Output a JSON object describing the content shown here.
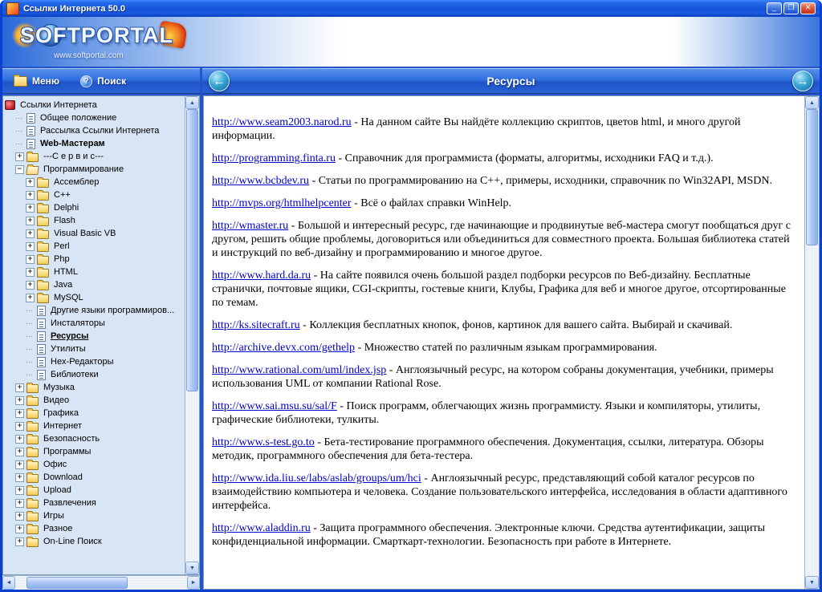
{
  "window": {
    "title": "Ссылки Интернета 50.0"
  },
  "banner": {
    "logo": "SOFTPORTAL",
    "site": "www.softportal.com"
  },
  "toolbar": {
    "menu": "Меню",
    "search": "Поиск"
  },
  "panel": {
    "title": "Ресурсы"
  },
  "icons": {
    "minimize": "_",
    "maximize": "❐",
    "close": "✕",
    "arrow_left": "←",
    "arrow_right": "→",
    "scroll_up": "▲",
    "scroll_down": "▼",
    "scroll_left": "◄",
    "scroll_right": "►",
    "help": "?",
    "plus": "+",
    "minus": "−"
  },
  "colors": {
    "titlebar": "#1a5ae0",
    "link": "#0000cc",
    "tree_bg": "#d8e5f4",
    "winbg": "#2355c8"
  },
  "tree": {
    "items": [
      {
        "label": "Ссылки Интернета",
        "icon": "root",
        "expand": "none",
        "level": 0
      },
      {
        "label": "Общее положение",
        "icon": "doc",
        "expand": "none",
        "level": 1
      },
      {
        "label": "Рассылка Ссылки Интернета",
        "icon": "doc",
        "expand": "none",
        "level": 1
      },
      {
        "label": "Web-Мастерам",
        "icon": "doc",
        "expand": "none",
        "level": 1,
        "bold": true
      },
      {
        "label": "---С е р в и с---",
        "icon": "folder",
        "expand": "plus",
        "level": 1
      },
      {
        "label": "Программирование",
        "icon": "folder-open",
        "expand": "minus",
        "level": 1
      },
      {
        "label": "Ассемблер",
        "icon": "folder",
        "expand": "plus",
        "level": 2
      },
      {
        "label": "C++",
        "icon": "folder",
        "expand": "plus",
        "level": 2
      },
      {
        "label": "Delphi",
        "icon": "folder",
        "expand": "plus",
        "level": 2
      },
      {
        "label": "Flash",
        "icon": "folder",
        "expand": "plus",
        "level": 2
      },
      {
        "label": "Visual Basic VB",
        "icon": "folder",
        "expand": "plus",
        "level": 2
      },
      {
        "label": "Perl",
        "icon": "folder",
        "expand": "plus",
        "level": 2
      },
      {
        "label": "Php",
        "icon": "folder",
        "expand": "plus",
        "level": 2
      },
      {
        "label": "HTML",
        "icon": "folder",
        "expand": "plus",
        "level": 2
      },
      {
        "label": "Java",
        "icon": "folder",
        "expand": "plus",
        "level": 2
      },
      {
        "label": "MySQL",
        "icon": "folder",
        "expand": "plus",
        "level": 2
      },
      {
        "label": "Другие языки программиров...",
        "icon": "doc",
        "expand": "none",
        "level": 2
      },
      {
        "label": "Инсталяторы",
        "icon": "doc",
        "expand": "none",
        "level": 2
      },
      {
        "label": "Ресурсы",
        "icon": "doc",
        "expand": "none",
        "level": 2,
        "bold": true,
        "selected": true
      },
      {
        "label": "Утилиты",
        "icon": "doc",
        "expand": "none",
        "level": 2
      },
      {
        "label": "Hex-Редакторы",
        "icon": "doc",
        "expand": "none",
        "level": 2
      },
      {
        "label": "Библиотеки",
        "icon": "doc",
        "expand": "none",
        "level": 2
      },
      {
        "label": "Музыка",
        "icon": "folder",
        "expand": "plus",
        "level": 1
      },
      {
        "label": "Видео",
        "icon": "folder",
        "expand": "plus",
        "level": 1
      },
      {
        "label": "Графика",
        "icon": "folder",
        "expand": "plus",
        "level": 1
      },
      {
        "label": "Интернет",
        "icon": "folder",
        "expand": "plus",
        "level": 1
      },
      {
        "label": "Безопасность",
        "icon": "folder",
        "expand": "plus",
        "level": 1
      },
      {
        "label": "Программы",
        "icon": "folder",
        "expand": "plus",
        "level": 1
      },
      {
        "label": "Офис",
        "icon": "folder",
        "expand": "plus",
        "level": 1
      },
      {
        "label": "Download",
        "icon": "folder",
        "expand": "plus",
        "level": 1
      },
      {
        "label": "Upload",
        "icon": "folder",
        "expand": "plus",
        "level": 1
      },
      {
        "label": "Развлечения",
        "icon": "folder",
        "expand": "plus",
        "level": 1
      },
      {
        "label": "Игры",
        "icon": "folder",
        "expand": "plus",
        "level": 1
      },
      {
        "label": "Разное",
        "icon": "folder",
        "expand": "plus",
        "level": 1
      },
      {
        "label": "On-Line Поиск",
        "icon": "folder",
        "expand": "plus",
        "level": 1
      }
    ]
  },
  "content": {
    "entries": [
      {
        "url": "http://www.seam2003.narod.ru",
        "text": "На данном сайте Вы найдёте коллекцию скриптов, цветов html, и много другой информации."
      },
      {
        "url": "http://programming.finta.ru",
        "text": "Справочник для программиста (форматы, алгоритмы, исходники FAQ и т.д.)."
      },
      {
        "url": "http://www.bcbdev.ru",
        "text": "Статьи по программированию на C++, примеры, исходники, справочник по Win32API, MSDN."
      },
      {
        "url": "http://mvps.org/htmlhelpcenter",
        "text": "Всё о файлах справки WinHelp."
      },
      {
        "url": "http://wmaster.ru",
        "text": "Большой и интересный ресурс, где начинающие и продвинутые веб-мастера смогут пообщаться друг с другом, решить общие проблемы, договориться или объединиться для совместного проекта. Большая библиотека статей и инструкций по веб-дизайну и программированию и многое другое."
      },
      {
        "url": "http://www.hard.da.ru",
        "text": "На сайте появился очень большой раздел подборки ресурсов по Веб-дизайну. Бесплатные странички, почтовые ящики, CGI-скрипты, гостевые книги, Клубы, Графика для веб и многое другое, отсортированные по темам."
      },
      {
        "url": "http://ks.sitecraft.ru",
        "text": "Коллекция бесплатных кнопок, фонов, картинок для вашего сайта. Выбирай и скачивай."
      },
      {
        "url": "http://archive.devx.com/gethelp",
        "text": "Множество статей по различным языкам программирования."
      },
      {
        "url": "http://www.rational.com/uml/index.jsp",
        "text": "Англоязычный ресурс, на котором собраны документация, учебники, примеры использования UML от компании Rational Rose."
      },
      {
        "url": "http://www.sai.msu.su/sal/F",
        "text": "Поиск программ, облегчающих жизнь программисту. Языки и компиляторы, утилиты, графические библиотеки, тулкиты."
      },
      {
        "url": "http://www.s-test.go.to",
        "text": "Бета-тестирование программного обеспечения. Документация, ссылки, литература. Обзоры методик, программного обеспечения для бета-тестера."
      },
      {
        "url": "http://www.ida.liu.se/labs/aslab/groups/um/hci",
        "text": "Англоязычный ресурс, представляющий собой каталог ресурсов по взаимодействию компьютера и человека. Создание пользовательского интерфейса, исследования в области адаптивного интерфейса."
      },
      {
        "url": "http://www.aladdin.ru",
        "text": "Защита программного обеспечения. Электронные ключи. Средства аутентификации, защиты конфиденциальной информации. Смарткарт-технологии. Безопасность при работе в Интернете."
      }
    ]
  }
}
